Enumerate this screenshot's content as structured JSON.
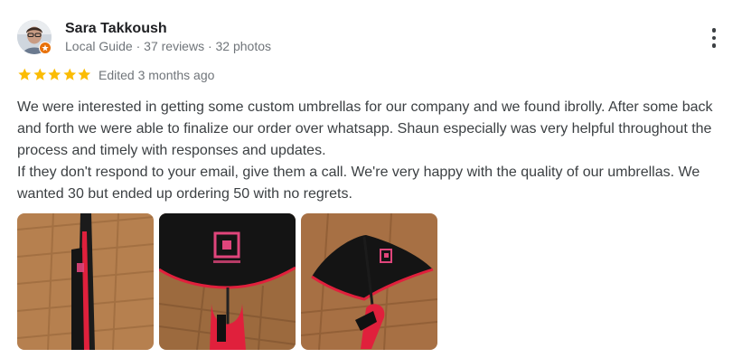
{
  "reviewer": {
    "name": "Sara Takkoush",
    "meta": "Local Guide · 37 reviews · 32 photos"
  },
  "rating": {
    "stars": 5,
    "max": 5,
    "color": "#fbbc04"
  },
  "edited": "Edited 3 months ago",
  "review_text": [
    "We were interested in getting some custom umbrellas for our company and we found ibrolly. After some back and forth we were able to finalize our order over whatsapp. Shaun especially was very helpful throughout the process and timely with responses and updates.",
    "If they don't respond to your email, give them a call. We're very happy with the quality of our umbrellas. We wanted 30 but ended up ordering 50 with no regrets."
  ],
  "photos": [
    {
      "icon": "photo-closed-umbrella"
    },
    {
      "icon": "photo-open-umbrella-inside"
    },
    {
      "icon": "photo-open-umbrella-side"
    }
  ],
  "colors": {
    "guide_badge": "#e8710a",
    "accent_pink": "#e0457b",
    "star": "#fbbc04"
  }
}
